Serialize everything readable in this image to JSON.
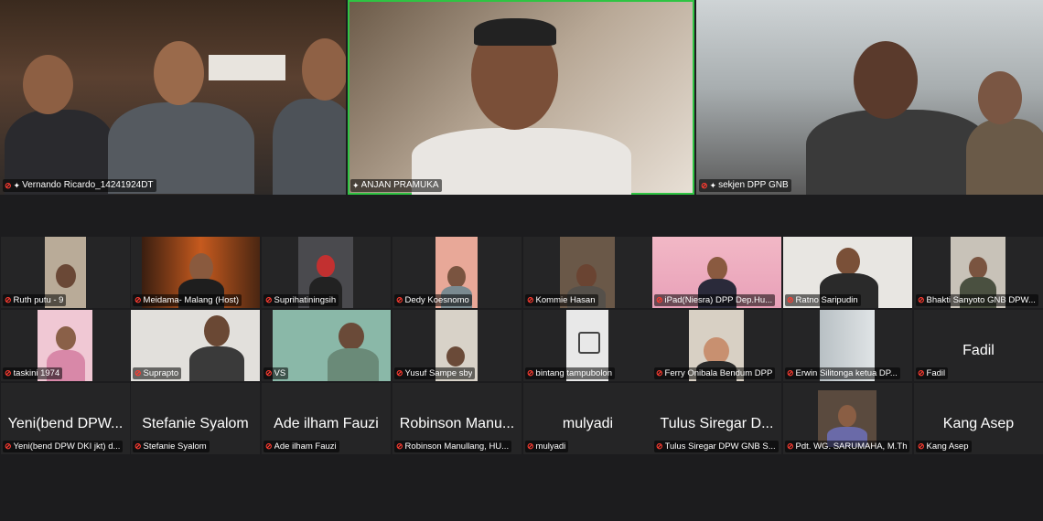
{
  "speakers": [
    {
      "name": "Vernando Ricardo_14241924DT",
      "pinned": true,
      "muted": true
    },
    {
      "name": "ANJAN PRAMUKA",
      "pinned": true,
      "muted": false,
      "active": true
    },
    {
      "name": "sekjen DPP GNB",
      "pinned": true,
      "muted": true
    }
  ],
  "participants": [
    {
      "name": "Ruth putu - 9",
      "display": ""
    },
    {
      "name": "Meidama- Malang (Host)",
      "display": ""
    },
    {
      "name": "Suprihatiningsih",
      "display": ""
    },
    {
      "name": "Dedy Koesnomo",
      "display": ""
    },
    {
      "name": "Kommie Hasan",
      "display": ""
    },
    {
      "name": "iPad(Niesra) DPP Dep.Hu...",
      "display": ""
    },
    {
      "name": "Ratno Saripudin",
      "display": ""
    },
    {
      "name": "Bhakti Sanyoto GNB DPW...",
      "display": ""
    },
    {
      "name": "taskini 1974",
      "display": ""
    },
    {
      "name": "Suprapto",
      "display": ""
    },
    {
      "name": "VS",
      "display": ""
    },
    {
      "name": "Yusuf Sampe sby",
      "display": ""
    },
    {
      "name": "bintang tampubolon",
      "display": ""
    },
    {
      "name": "Ferry Onibala Bendum DPP",
      "display": ""
    },
    {
      "name": "Erwin Silitonga ketua DP...",
      "display": ""
    },
    {
      "name": "Fadil",
      "display": "Fadil"
    },
    {
      "name": "Yeni(bend DPW DKI jkt) d...",
      "display": "Yeni(bend DPW..."
    },
    {
      "name": "Stefanie Syalom",
      "display": "Stefanie Syalom"
    },
    {
      "name": "Ade ilham Fauzi",
      "display": "Ade ilham Fauzi"
    },
    {
      "name": "Robinson Manullang, HU...",
      "display": "Robinson Manu..."
    },
    {
      "name": "mulyadi",
      "display": "mulyadi"
    },
    {
      "name": "Tulus Siregar DPW GNB S...",
      "display": "Tulus Siregar D..."
    },
    {
      "name": "Pdt. WG. SARUMAHA, M.Th",
      "display": ""
    },
    {
      "name": "Kang Asep",
      "display": "Kang Asep"
    }
  ],
  "icons": {
    "muted": "mic-muted-icon",
    "pinned": "pin-icon"
  },
  "colors": {
    "background": "#1c1c1e",
    "tile": "#252526",
    "active_border": "#2fc443",
    "muted_mic": "#ff3b30"
  }
}
